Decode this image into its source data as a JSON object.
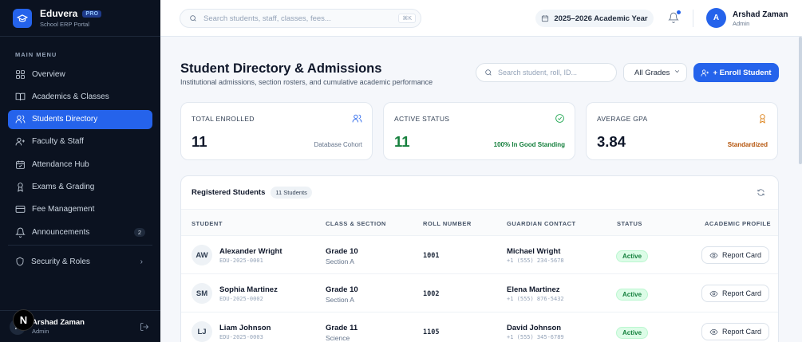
{
  "brand": {
    "name": "Eduvera",
    "badge": "PRO",
    "subtitle": "School ERP Portal"
  },
  "sidebar": {
    "menu_heading": "MAIN MENU",
    "items": [
      {
        "label": "Overview",
        "icon": "grid-icon"
      },
      {
        "label": "Academics & Classes",
        "icon": "book-icon"
      },
      {
        "label": "Students Directory",
        "icon": "users-icon",
        "active": true
      },
      {
        "label": "Faculty & Staff",
        "icon": "user-plus-icon"
      },
      {
        "label": "Attendance Hub",
        "icon": "calendar-check-icon"
      },
      {
        "label": "Exams & Grading",
        "icon": "award-icon"
      },
      {
        "label": "Fee Management",
        "icon": "credit-card-icon"
      },
      {
        "label": "Announcements",
        "icon": "bell-icon",
        "badge": "2"
      }
    ],
    "security_label": "Security & Roles",
    "footer": {
      "initials": "A",
      "name": "Arshad Zaman",
      "role": "Admin"
    }
  },
  "topbar": {
    "search_placeholder": "Search students, staff, classes, fees...",
    "shortcut": "⌘K",
    "academic_year": "2025–2026 Academic Year",
    "user": {
      "initials": "A",
      "name": "Arshad Zaman",
      "role": "Admin"
    }
  },
  "page": {
    "title": "Student Directory & Admissions",
    "subtitle": "Institutional admissions, section rosters, and cumulative academic performance",
    "search_placeholder": "Search student, roll, ID...",
    "grade_filter": "All Grades",
    "enroll_label": "+ Enroll Student"
  },
  "stats": [
    {
      "label": "TOTAL ENROLLED",
      "value": "11",
      "note": "Database Cohort",
      "icon": "users-icon",
      "value_color": "#0f172a",
      "note_color": "#64748b",
      "icon_color": "#2563eb"
    },
    {
      "label": "ACTIVE STATUS",
      "value": "11",
      "note": "100% In Good Standing",
      "icon": "check-circle-icon",
      "value_color": "#15803d",
      "note_color": "#15803d",
      "icon_color": "#16a34a"
    },
    {
      "label": "AVERAGE GPA",
      "value": "3.84",
      "note": "Standardized",
      "icon": "award-icon",
      "value_color": "#0f172a",
      "note_color": "#b45309",
      "icon_color": "#d97706"
    }
  ],
  "table": {
    "title": "Registered Students",
    "count": "11 Students",
    "columns": [
      "STUDENT",
      "CLASS & SECTION",
      "ROLL NUMBER",
      "GUARDIAN CONTACT",
      "STATUS",
      "ACADEMIC PROFILE"
    ],
    "report_label": "Report Card",
    "rows": [
      {
        "initials": "AW",
        "name": "Alexander Wright",
        "id": "EDU-2025-0001",
        "grade": "Grade 10",
        "section": "Section A",
        "roll": "1001",
        "guardian": "Michael Wright",
        "phone": "+1 (555) 234-5678",
        "status": "Active"
      },
      {
        "initials": "SM",
        "name": "Sophia Martinez",
        "id": "EDU-2025-0002",
        "grade": "Grade 10",
        "section": "Section A",
        "roll": "1002",
        "guardian": "Elena Martinez",
        "phone": "+1 (555) 876-5432",
        "status": "Active"
      },
      {
        "initials": "LJ",
        "name": "Liam Johnson",
        "id": "EDU-2025-0003",
        "grade": "Grade 11",
        "section": "Science",
        "roll": "1105",
        "guardian": "David Johnson",
        "phone": "+1 (555) 345-6789",
        "status": "Active"
      }
    ]
  },
  "colors": {
    "accent": "#2563eb",
    "sidebar_bg": "#0b1220",
    "success": "#15803d"
  }
}
